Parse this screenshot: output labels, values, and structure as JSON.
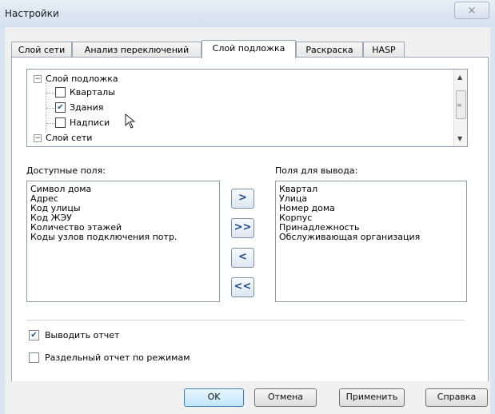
{
  "window": {
    "title": "Настройки",
    "close_icon": "×"
  },
  "tabs": [
    {
      "label": "Слой сети",
      "active": false
    },
    {
      "label": "Анализ переключений",
      "active": false
    },
    {
      "label": "Слой подложка",
      "active": true
    },
    {
      "label": "Раскраска",
      "active": false
    },
    {
      "label": "HASP",
      "active": false
    }
  ],
  "tree": {
    "root1": {
      "label": "Слой подложка",
      "expander": "−"
    },
    "children": [
      {
        "label": "Кварталы",
        "checked": false,
        "mark": ""
      },
      {
        "label": "Здания",
        "checked": true,
        "mark": "✔"
      },
      {
        "label": "Надписи",
        "checked": false,
        "mark": ""
      }
    ],
    "root2": {
      "label": "Слой сети",
      "expander": "−"
    }
  },
  "available": {
    "label": "Доступные поля:",
    "items": [
      "Символ дома",
      "Адрес",
      "Код улицы",
      "Код ЖЭУ",
      "Количество этажей",
      "Коды узлов подключения потр."
    ]
  },
  "output": {
    "label": "Поля для вывода:",
    "items": [
      "Квартал",
      "Улица",
      "Номер дома",
      "Корпус",
      "Принадлежность",
      "Обслуживающая организация"
    ]
  },
  "move_buttons": {
    "add_one": ">",
    "add_all": ">>",
    "remove_one": "<",
    "remove_all": "<<"
  },
  "options": {
    "report": {
      "label": "Выводить отчет",
      "checked": true,
      "mark": "✔"
    },
    "separate_report": {
      "label": "Раздельный отчет по режимам",
      "checked": false,
      "mark": ""
    }
  },
  "buttons": {
    "ok": "OK",
    "cancel": "Отмена",
    "apply": "Применить",
    "help": "Справка"
  },
  "scroll": {
    "up": "▲",
    "down": "▼",
    "grip": "≡"
  }
}
